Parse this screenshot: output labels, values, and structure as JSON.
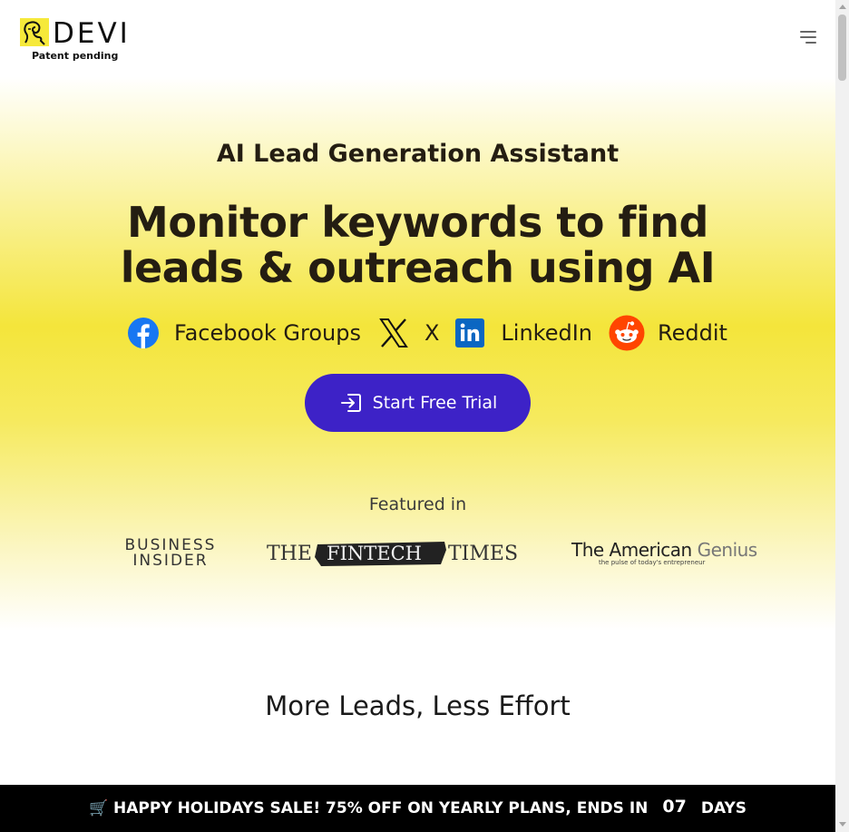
{
  "header": {
    "logo_text": "DEVI",
    "logo_sub": "Patent pending",
    "menu_icon": "hamburger-menu-icon"
  },
  "hero": {
    "eyebrow": "AI Lead Generation Assistant",
    "headline_line1": "Monitor keywords to find",
    "headline_line2": "leads & outreach using AI",
    "platforms": [
      {
        "label": "Facebook Groups",
        "icon": "facebook-icon",
        "color": "#1877f2"
      },
      {
        "label": "X",
        "icon": "x-icon",
        "color": "#000000"
      },
      {
        "label": "LinkedIn",
        "icon": "linkedin-icon",
        "color": "#0a66c2"
      },
      {
        "label": "Reddit",
        "icon": "reddit-icon",
        "color": "#ff4500"
      }
    ],
    "cta_label": "Start Free Trial",
    "cta_icon": "sign-in-icon",
    "cta_color": "#3d22c7"
  },
  "featured": {
    "label": "Featured in",
    "logos": {
      "business_insider": [
        "BUSINESS",
        "INSIDER"
      ],
      "fintech": [
        "THE",
        "FINTECH",
        "TIMES"
      ],
      "american_genius_a": "The American ",
      "american_genius_b": "Genius",
      "american_genius_tagline": "the pulse of today's entrepreneur"
    }
  },
  "section": {
    "title": "More Leads, Less Effort"
  },
  "banner": {
    "text": "🛒 HAPPY HOLIDAYS SALE! 75% OFF ON YEARLY PLANS, ENDS IN",
    "count": "07",
    "unit": "DAYS"
  },
  "colors": {
    "brand_yellow": "#f4e53b",
    "accent": "#3d22c7",
    "banner_bg": "#000000"
  }
}
